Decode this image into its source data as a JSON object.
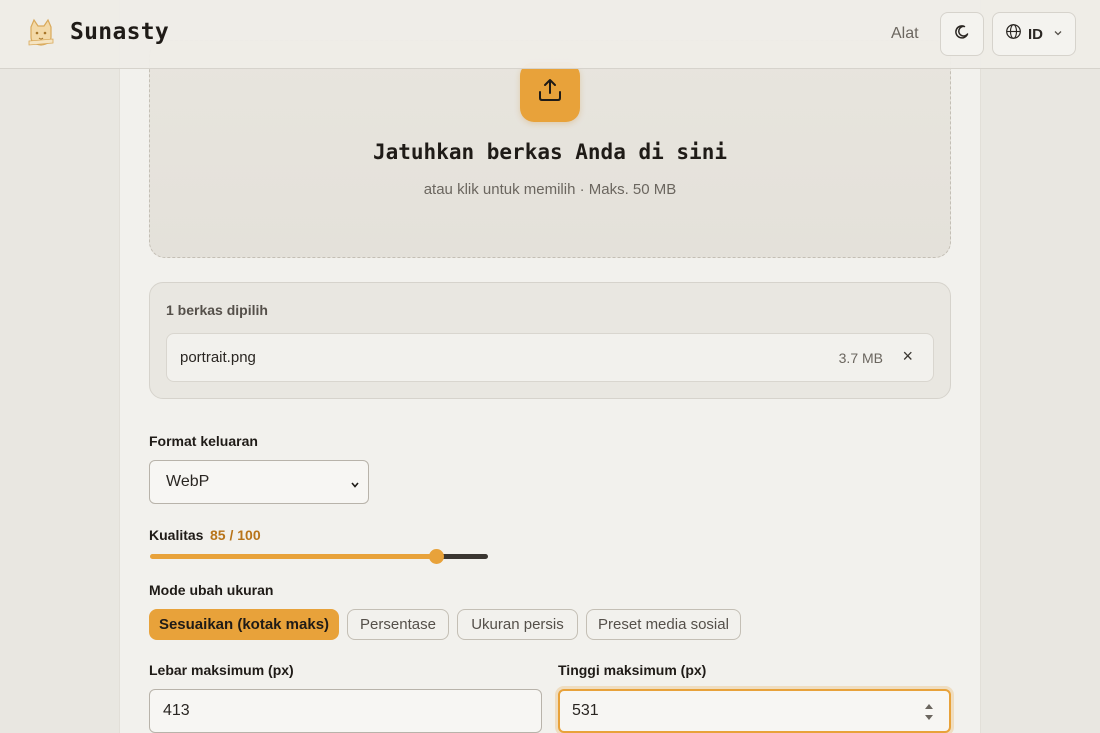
{
  "header": {
    "brand": "Sunasty",
    "nav_tools": "Alat",
    "language_code": "ID",
    "icons": {
      "logo": "cat-logo-icon",
      "theme": "moon-icon",
      "language": "globe-icon",
      "language_caret": "chevron-down-icon"
    }
  },
  "dropzone": {
    "title": "Jatuhkan berkas Anda di sini",
    "subtitle": "atau klik untuk memilih · Maks. 50 MB",
    "icon": "upload-icon"
  },
  "files": {
    "count_label": "1 berkas dipilih",
    "items": [
      {
        "name": "portrait.png",
        "size": "3.7 MB",
        "remove": "×"
      }
    ]
  },
  "form": {
    "format_label": "Format keluaran",
    "format_value": "WebP",
    "quality_label": "Kualitas",
    "quality_value_text": "85 / 100",
    "quality_value": 85,
    "quality_max": 100,
    "resize_mode_label": "Mode ubah ukuran",
    "resize_modes": [
      {
        "label": "Sesuaikan (kotak maks)",
        "active": true
      },
      {
        "label": "Persentase",
        "active": false
      },
      {
        "label": "Ukuran persis",
        "active": false
      },
      {
        "label": "Preset media sosial",
        "active": false
      }
    ],
    "max_width_label": "Lebar maksimum (px)",
    "max_width_value": "413",
    "max_height_label": "Tinggi maksimum (px)",
    "max_height_value": "531"
  },
  "colors": {
    "accent": "#e8a23a",
    "background": "#e9e7e1",
    "card": "#f2f1ed",
    "text": "#1f1b17"
  }
}
